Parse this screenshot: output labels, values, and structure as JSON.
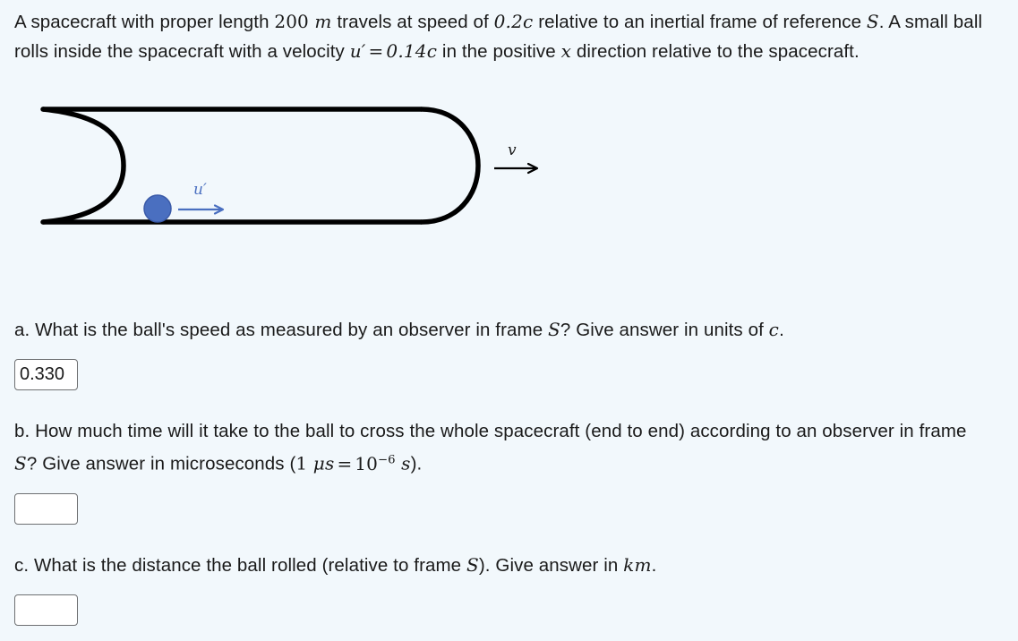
{
  "problem": {
    "text_1": "A spacecraft with proper length ",
    "length_value": "200",
    "length_unit": "m",
    "text_2": " travels at speed of ",
    "speed_value": "0.2c",
    "text_3": " relative to an inertial frame of reference ",
    "frame_symbol": "S",
    "text_4": ". A small ball rolls inside the spacecraft with a velocity ",
    "ball_velocity_symbol": "u′",
    "equals": "=",
    "ball_velocity_value": "0.14c",
    "text_5": " in the positive ",
    "axis_symbol": "x",
    "text_6": " direction relative to the spacecraft."
  },
  "figure": {
    "name": "spacecraft-diagram",
    "spacecraft_label": "spacecraft-body",
    "ball_label": "ball",
    "ball_velocity_label": "u′",
    "craft_velocity_label": "v",
    "colors": {
      "outline": "#000000",
      "ball_fill": "#4a6fc0",
      "ball_stroke": "#3a5aa8",
      "ball_arrow": "#4a6fc0",
      "craft_arrow": "#000000",
      "background": "#f2f8fc"
    }
  },
  "questions": [
    {
      "id": "a",
      "prefix": "a. ",
      "text_1": "What is the ball's speed as measured by an observer in frame ",
      "frame_symbol": "S",
      "text_2": "? Give answer in units of ",
      "unit_symbol": "c",
      "text_3": ".",
      "answer_value": "0.330",
      "answer_placeholder": ""
    },
    {
      "id": "b",
      "prefix": "b. ",
      "text_1": "How much time will it take to the ball to cross the whole spacecraft (end to end) according to an observer in frame ",
      "frame_symbol": "S",
      "text_2": "? Give answer in microseconds (",
      "micro_one": "1",
      "micro_unit": "μs",
      "micro_equals": "=",
      "micro_base": "10",
      "micro_exp": "−6",
      "micro_sec": "s",
      "text_3": ").",
      "answer_value": "",
      "answer_placeholder": ""
    },
    {
      "id": "c",
      "prefix": "c. ",
      "text_1": "What is the distance the ball rolled (relative to frame ",
      "frame_symbol": "S",
      "text_2": "). Give answer in ",
      "unit_symbol": "km",
      "text_3": ".",
      "answer_value": "",
      "answer_placeholder": ""
    }
  ]
}
